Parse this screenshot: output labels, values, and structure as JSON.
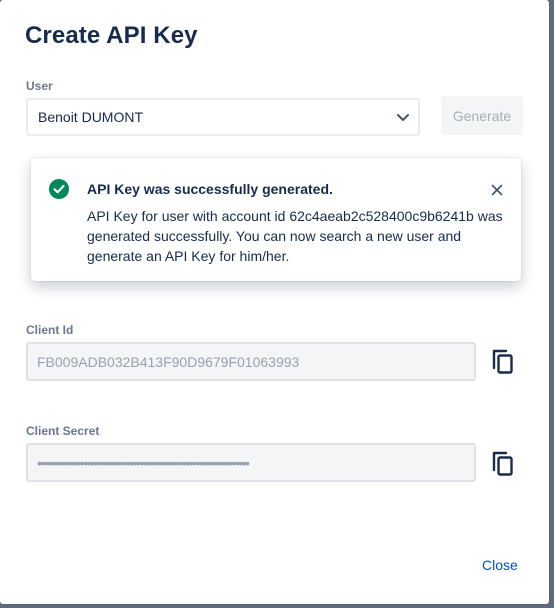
{
  "dialog": {
    "title": "Create API Key",
    "close_label": "Close"
  },
  "user": {
    "label": "User",
    "selected": "Benoit DUMONT",
    "generate_label": "Generate"
  },
  "flag": {
    "status": "success",
    "title": "API Key was successfully generated.",
    "body": "API Key for user with account id 62c4aeab2c528400c9b6241b was generated successfully. You can now search a new user and generate an API Key for him/her.",
    "icon": "success-check-icon"
  },
  "client_id": {
    "label": "Client Id",
    "value": "FB009ADB032B413F90D9679F01063993"
  },
  "client_secret": {
    "label": "Client Secret",
    "value": "••••••••••••••••••••••••••••••••••••••••••••••••••••••••••••••••"
  },
  "colors": {
    "primary_text": "#172b4d",
    "link": "#0052cc",
    "success": "#00875a",
    "muted": "#97a0af"
  }
}
